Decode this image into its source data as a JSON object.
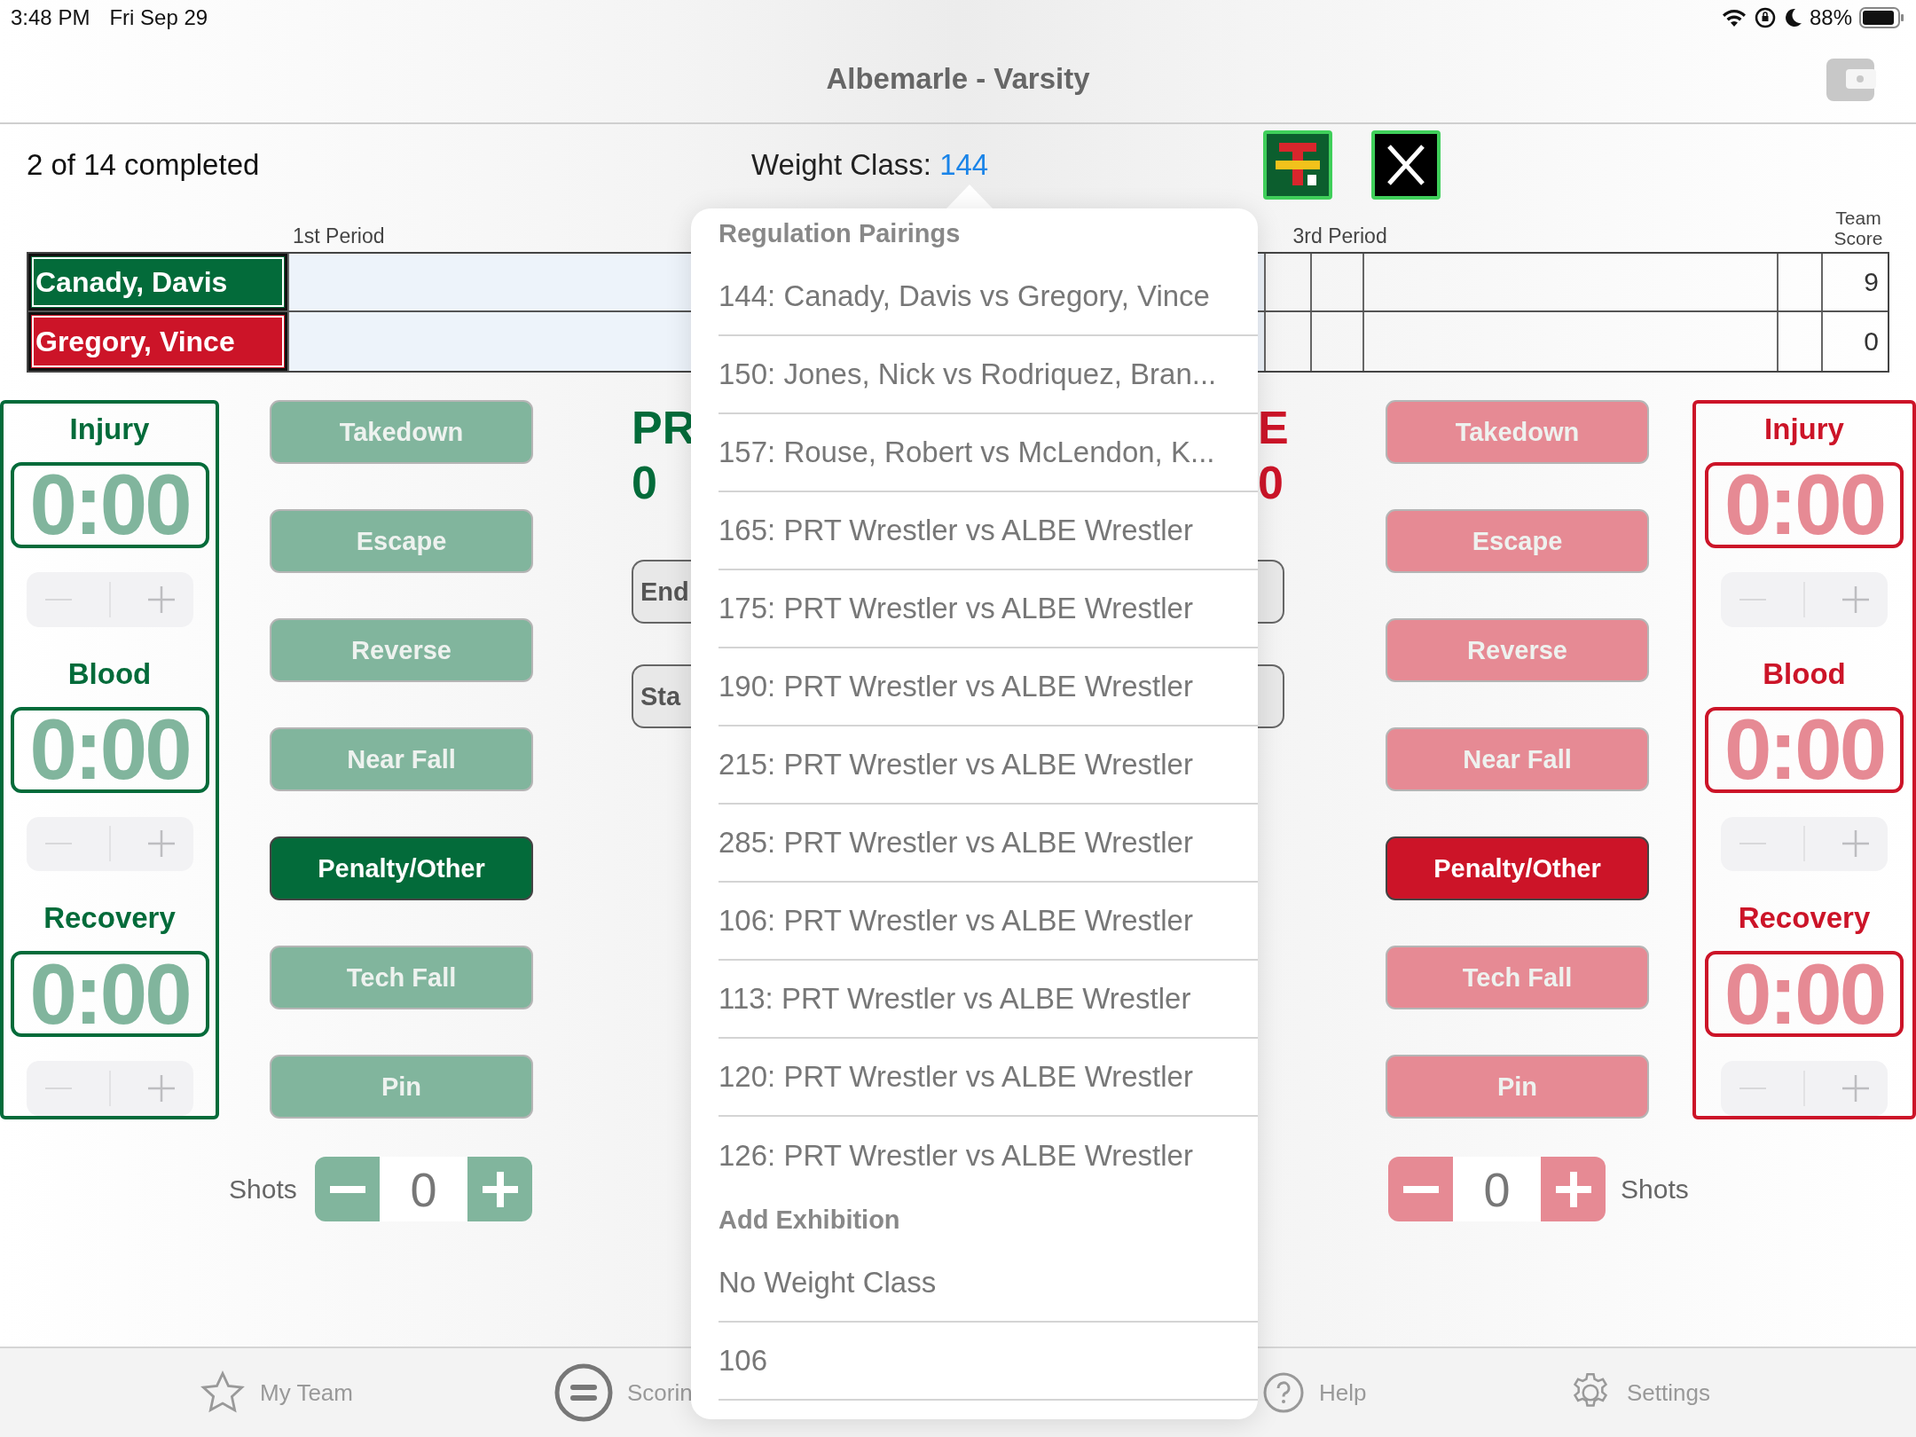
{
  "status_bar": {
    "time": "3:48 PM",
    "date": "Fri Sep 29",
    "battery": "88%"
  },
  "nav": {
    "title": "Albemarle - Varsity"
  },
  "progress": "2 of 14 completed",
  "weight_class": {
    "label": "Weight Class:",
    "value": "144"
  },
  "score_table": {
    "period_headers": [
      "1st Period",
      "3rd Period"
    ],
    "team_score_header": "Team Score",
    "wrestlers": [
      {
        "name": "Canady, Davis",
        "team_score": "9",
        "color": "#036b3a"
      },
      {
        "name": "Gregory, Vince",
        "team_score": "0",
        "color": "#cc1428"
      }
    ]
  },
  "sides": [
    {
      "timers": [
        {
          "label": "Injury",
          "time": "0:00"
        },
        {
          "label": "Blood",
          "time": "0:00"
        },
        {
          "label": "Recovery",
          "time": "0:00"
        }
      ],
      "actions": [
        {
          "label": "Takedown",
          "selected": false
        },
        {
          "label": "Escape",
          "selected": false
        },
        {
          "label": "Reverse",
          "selected": false
        },
        {
          "label": "Near Fall",
          "selected": false
        },
        {
          "label": "Penalty/Other",
          "selected": true
        },
        {
          "label": "Tech Fall",
          "selected": false
        },
        {
          "label": "Pin",
          "selected": false
        }
      ],
      "shots": {
        "label": "Shots",
        "value": "0"
      },
      "team": "PR",
      "score": "0",
      "buttons": [
        "End",
        "Sta"
      ]
    },
    {
      "timers": [
        {
          "label": "Injury",
          "time": "0:00"
        },
        {
          "label": "Blood",
          "time": "0:00"
        },
        {
          "label": "Recovery",
          "time": "0:00"
        }
      ],
      "actions": [
        {
          "label": "Takedown",
          "selected": false
        },
        {
          "label": "Escape",
          "selected": false
        },
        {
          "label": "Reverse",
          "selected": false
        },
        {
          "label": "Near Fall",
          "selected": false
        },
        {
          "label": "Penalty/Other",
          "selected": true
        },
        {
          "label": "Tech Fall",
          "selected": false
        },
        {
          "label": "Pin",
          "selected": false
        }
      ],
      "shots": {
        "label": "Shots",
        "value": "0"
      },
      "team": "E",
      "score": "0"
    }
  ],
  "popover": {
    "sections": [
      {
        "title": "Regulation Pairings",
        "items": [
          "144: Canady, Davis vs Gregory, Vince",
          "150: Jones, Nick vs Rodriquez, Bran...",
          "157: Rouse, Robert vs McLendon, K...",
          "165: PRT Wrestler vs ALBE Wrestler",
          "175: PRT Wrestler vs ALBE Wrestler",
          "190: PRT Wrestler vs ALBE Wrestler",
          "215: PRT Wrestler vs ALBE Wrestler",
          "285: PRT Wrestler vs ALBE Wrestler",
          "106: PRT Wrestler vs ALBE Wrestler",
          "113: PRT Wrestler vs ALBE Wrestler",
          "120: PRT Wrestler vs ALBE Wrestler",
          "126: PRT Wrestler vs ALBE Wrestler"
        ]
      },
      {
        "title": "Add Exhibition",
        "items": [
          "No Weight Class",
          "106"
        ]
      }
    ]
  },
  "tab_bar": [
    {
      "label": "My Team"
    },
    {
      "label": "Scorin"
    },
    {
      "label": "Help"
    },
    {
      "label": "Settings"
    }
  ]
}
